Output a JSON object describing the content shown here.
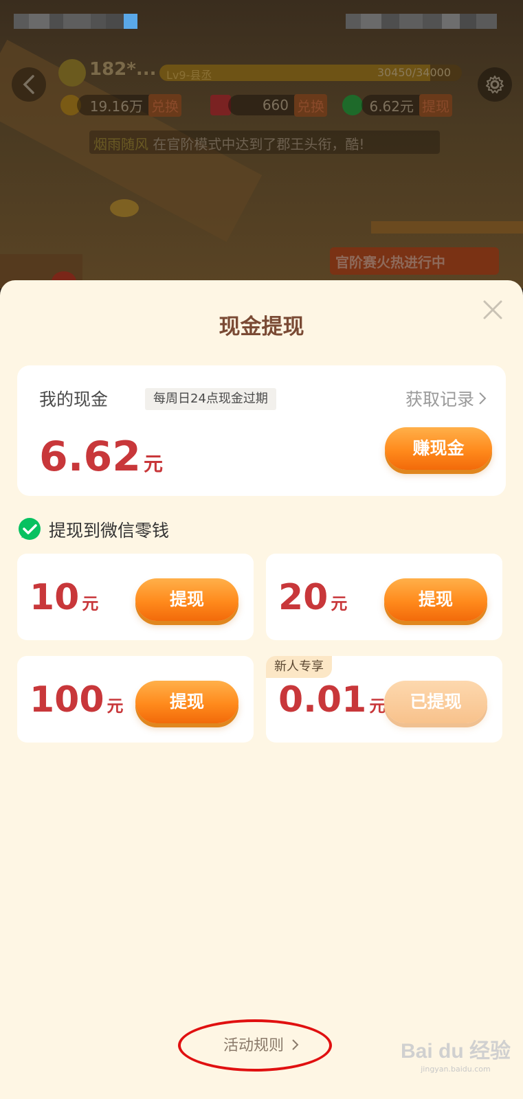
{
  "background": {
    "user": {
      "name": "182*..."
    },
    "level": {
      "name": "Lv9-县丞",
      "progress_text": "30450/34000",
      "progress_fraction": 0.8956
    },
    "resources": [
      {
        "value": "19.16万",
        "action": "兑换",
        "icon": "ingot-icon"
      },
      {
        "value": "660",
        "action": "兑换",
        "icon": "gift-icon"
      },
      {
        "value": "6.62元",
        "action": "提现",
        "icon": "cash-check-icon"
      }
    ],
    "marquee": {
      "highlight": "烟雨随风",
      "text": " 在官阶模式中达到了郡王头衔，酷!"
    },
    "event_banner": "官阶赛火热进行中"
  },
  "modal": {
    "title": "现金提现",
    "cash": {
      "label": "我的现金",
      "expire_note": "每周日24点现金过期",
      "record_link": "获取记录",
      "amount": "6.62",
      "unit": "元",
      "earn_button": "赚现金"
    },
    "withdraw_target": "提现到微信零钱",
    "options": [
      {
        "amount": "10",
        "unit": "元",
        "button": "提现",
        "done": false
      },
      {
        "amount": "20",
        "unit": "元",
        "button": "提现",
        "done": false
      },
      {
        "amount": "100",
        "unit": "元",
        "button": "提现",
        "done": false
      },
      {
        "amount": "0.01",
        "unit": "元",
        "button": "已提现",
        "done": true,
        "tag": "新人专享"
      }
    ],
    "rules_link": "活动规则"
  },
  "watermark": {
    "text": "Bai du 经验",
    "sub": "jingyan.baidu.com"
  },
  "colors": {
    "sheet_bg": "#fef6e4",
    "title": "#7a4a34",
    "amount_red": "#c8373a",
    "button_orange": "#ff8a1c",
    "wechat_green": "#07c160",
    "annotation_red": "#e01010"
  }
}
